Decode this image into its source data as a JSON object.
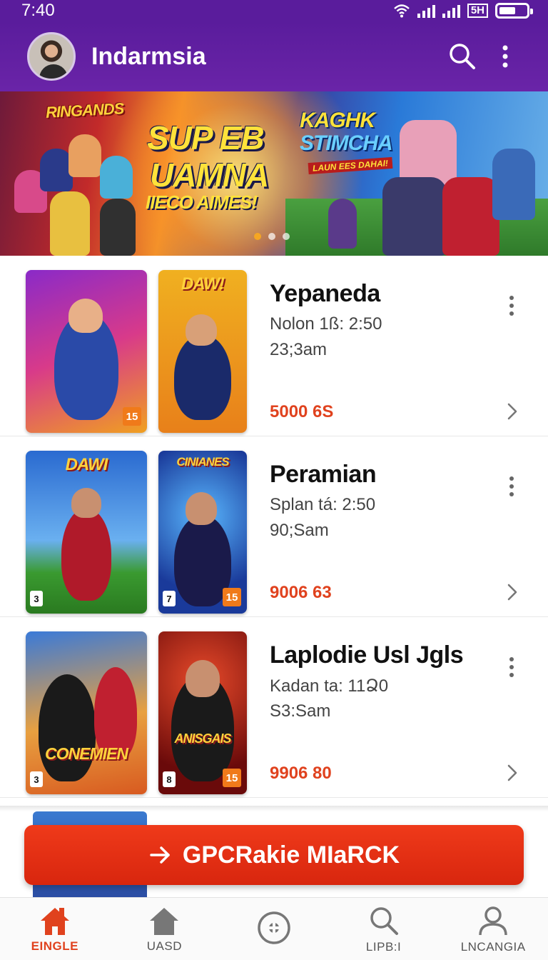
{
  "status_bar": {
    "time": "7:40",
    "network_badge": "5H"
  },
  "app_bar": {
    "title": "Indarmsia",
    "search_icon": "search-icon",
    "more_icon": "more-vertical-icon"
  },
  "banner": {
    "brand": "RINGANDS",
    "headline_1": "SUP EB",
    "headline_2": "UAMNA",
    "subline": "IIECO AIMES!",
    "tag_1": "KAGHK",
    "tag_2": "STIMCHA",
    "tag_3": "LAUN EES DAHAI!",
    "active_slide": 1,
    "slide_count": 3
  },
  "items": [
    {
      "name": "Yepaneda",
      "meta_1": "Nolon 1ß: 2:50",
      "meta_2": "23;3am",
      "price": "5000 6S",
      "thumb_a_rating": "15",
      "thumb_b_logo": "DAW!"
    },
    {
      "name": "Peramian",
      "meta_1": "Splan tá: 2:50",
      "meta_2": "90;Sam",
      "price": "9006 63",
      "thumb_a_logo": "DAWI",
      "thumb_a_rating": "3",
      "thumb_b_logo": "CINIANES",
      "thumb_b_rating": "15",
      "thumb_b_rating_left": "7"
    },
    {
      "name": "Laplodie Usl Jgls",
      "meta_1": "Kadan ta: 11Ձ0",
      "meta_2": "S3:Sam",
      "price": "9906 80",
      "thumb_a_logo": "CONEMIEN",
      "thumb_a_rating": "3",
      "thumb_b_logo": "ANISGAIS",
      "thumb_b_rating": "15",
      "thumb_b_rating_left": "8"
    }
  ],
  "cta": {
    "label": "GPCRakie MIaRCK",
    "icon": "arrow-right-icon"
  },
  "bottom_nav": [
    {
      "label": "EINGLE",
      "icon": "home-filled-icon",
      "active": true
    },
    {
      "label": "UASD",
      "icon": "home-icon",
      "active": false
    },
    {
      "label": "",
      "icon": "compass-icon",
      "active": false
    },
    {
      "label": "LIPB:I",
      "icon": "search-icon",
      "active": false
    },
    {
      "label": "LNCANGIA",
      "icon": "profile-icon",
      "active": false
    }
  ],
  "colors": {
    "primary": "#5a1c9c",
    "accent": "#e0421e",
    "cta": "#e2301a"
  }
}
